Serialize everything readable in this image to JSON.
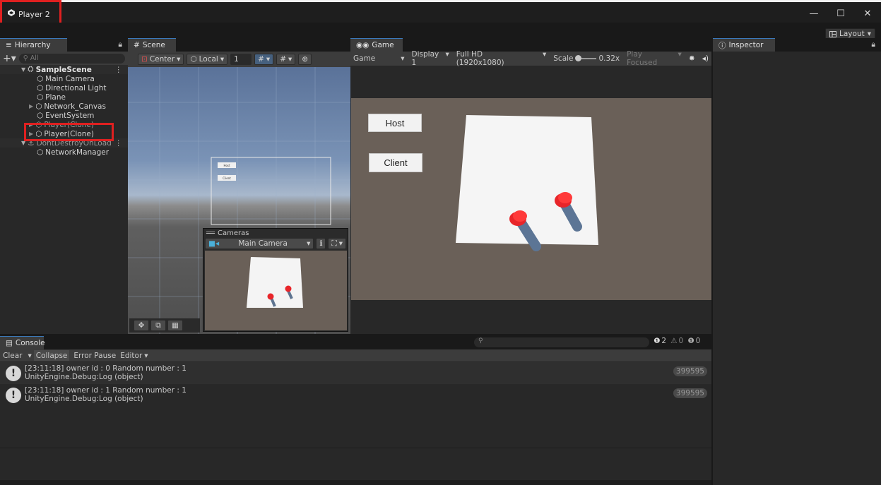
{
  "window": {
    "title": "Player 2",
    "controls": [
      "—",
      "☐",
      "✕"
    ]
  },
  "toolbar": {
    "layout_label": "Layout"
  },
  "hierarchy": {
    "tab_label": "Hierarchy",
    "search_placeholder": "All",
    "items": [
      {
        "label": "SampleScene",
        "depth": 0,
        "bold": true
      },
      {
        "label": "Main Camera",
        "depth": 1
      },
      {
        "label": "Directional Light",
        "depth": 1
      },
      {
        "label": "Plane",
        "depth": 1
      },
      {
        "label": "Network_Canvas",
        "depth": 1
      },
      {
        "label": "EventSystem",
        "depth": 1
      },
      {
        "label": "Player(Clone)",
        "depth": 1
      },
      {
        "label": "Player(Clone)",
        "depth": 1
      },
      {
        "label": "DontDestroyOnLoad",
        "depth": 0
      },
      {
        "label": "NetworkManager",
        "depth": 1
      }
    ]
  },
  "scene": {
    "tab_label": "Scene",
    "pivot": "Center",
    "space": "Local",
    "grid_value": "1",
    "canvas_buttons": [
      "Host",
      "Client"
    ],
    "cameras_overlay": {
      "title": "Cameras",
      "camera": "Main Camera"
    }
  },
  "game": {
    "tab_label": "Game",
    "view_mode": "Game",
    "display": "Display 1",
    "resolution": "Full HD (1920x1080)",
    "scale_label": "Scale",
    "scale_value": "0.32x",
    "play_mode": "Play Focused",
    "host_button": "Host",
    "client_button": "Client"
  },
  "inspector": {
    "tab_label": "Inspector"
  },
  "console": {
    "tab_label": "Console",
    "clear": "Clear",
    "collapse": "Collapse",
    "error_pause": "Error Pause",
    "editor": "Editor",
    "counts": {
      "log": "2",
      "warning": "0",
      "error": "0"
    },
    "logs": [
      {
        "line1": "[23:11:18] owner id : 0 Random number : 1",
        "line2": "UnityEngine.Debug:Log (object)",
        "count": "399595"
      },
      {
        "line1": "[23:11:18] owner id : 1 Random number : 1",
        "line2": "UnityEngine.Debug:Log (object)",
        "count": "399595"
      }
    ]
  },
  "colors": {
    "accent": "#3a79bb",
    "highlight_box": "#e02020",
    "player_red": "#e8252a",
    "game_floor": "#6a6058"
  }
}
